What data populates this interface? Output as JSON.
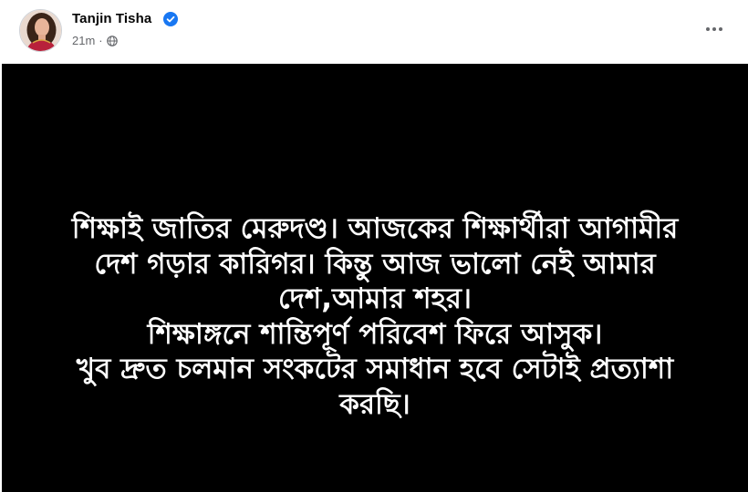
{
  "post": {
    "author": {
      "name": "Tanjin Tisha",
      "verified": true,
      "avatar_icon": "profile-photo"
    },
    "meta": {
      "time": "21m",
      "separator": "·",
      "audience_icon": "globe-icon"
    },
    "more_icon": "more-horizontal-icon",
    "colors": {
      "background": "#000000",
      "text": "#ffffff",
      "verified": "#1877f2",
      "meta": "#65676b"
    },
    "text_lines": [
      "শিক্ষাই জাতির মেরুদণ্ড। আজকের শিক্ষার্থীরা আগামীর",
      "দেশ গড়ার কারিগর। কিন্তু আজ ভালো নেই আমার",
      "দেশ,আমার শহর।",
      "শিক্ষাঙ্গনে শান্তিপূর্ণ পরিবেশ ফিরে আসুক।",
      "খুব দ্রুত চলমান সংকটের সমাধান হবে সেটাই প্রত্যাশা",
      "করছি।"
    ]
  }
}
